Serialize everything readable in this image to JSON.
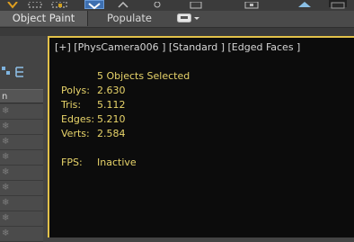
{
  "ribbon": {
    "tabs": [
      {
        "label": "Object Paint"
      },
      {
        "label": "Populate"
      }
    ]
  },
  "left_panel": {
    "header_label": "n"
  },
  "viewport": {
    "label": "[+] [PhysCamera006 ] [Standard ] [Edged Faces ]",
    "selection": "5 Objects Selected",
    "stats": [
      {
        "label": "Polys:",
        "value": "2.630"
      },
      {
        "label": "Tris:",
        "value": "5.112"
      },
      {
        "label": "Edges:",
        "value": "5.210"
      },
      {
        "label": "Verts:",
        "value": "2.584"
      }
    ],
    "fps": {
      "label": "FPS:",
      "value": "Inactive"
    }
  },
  "colors": {
    "viewport_border": "#e2c14a",
    "stats_text": "#e8d46a",
    "viewport_bg": "#0c0c0c"
  }
}
